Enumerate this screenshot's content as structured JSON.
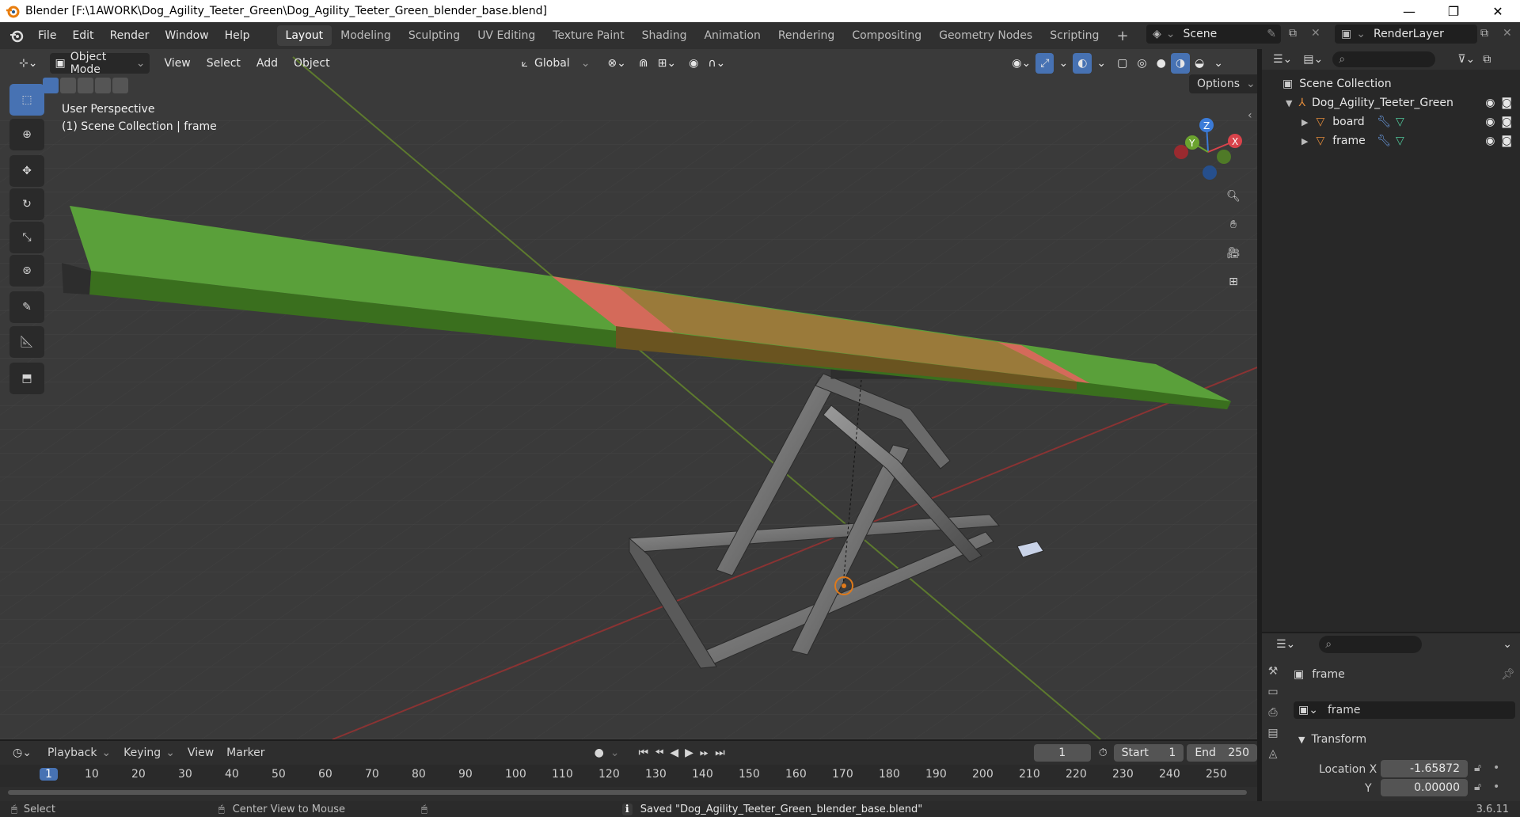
{
  "window": {
    "title": "Blender [F:\\1AWORK\\Dog_Agility_Teeter_Green\\Dog_Agility_Teeter_Green_blender_base.blend]",
    "minimize": "—",
    "maximize": "❐",
    "close": "✕"
  },
  "menus": [
    "File",
    "Edit",
    "Render",
    "Window",
    "Help"
  ],
  "workspaces": [
    "Layout",
    "Modeling",
    "Sculpting",
    "UV Editing",
    "Texture Paint",
    "Shading",
    "Animation",
    "Rendering",
    "Compositing",
    "Geometry Nodes",
    "Scripting"
  ],
  "active_workspace": "Layout",
  "scene": {
    "name": "Scene",
    "render_layer": "RenderLayer"
  },
  "viewport_header": {
    "mode": "Object Mode",
    "menus": [
      "View",
      "Select",
      "Add",
      "Object"
    ],
    "orientation": "Global",
    "options": "Options"
  },
  "viewport_info": {
    "line1": "User Perspective",
    "line2": "(1) Scene Collection | frame"
  },
  "gizmo": {
    "x": "X",
    "y": "Y",
    "z": "Z"
  },
  "outliner": {
    "scene_collection": "Scene Collection",
    "collection": "Dog_Agility_Teeter_Green",
    "objects": [
      "board",
      "frame"
    ]
  },
  "properties": {
    "object_name": "frame",
    "object_name_field": "frame",
    "panel": "Transform",
    "location_x_label": "Location X",
    "location_x": "-1.65872",
    "location_y_label": "Y",
    "location_y": "0.00000"
  },
  "timeline": {
    "menus": [
      "Playback",
      "Keying",
      "View",
      "Marker"
    ],
    "current_frame": "1",
    "start_label": "Start",
    "start": "1",
    "end_label": "End",
    "end": "250",
    "ruler": [
      "1",
      "10",
      "20",
      "30",
      "40",
      "50",
      "60",
      "70",
      "80",
      "90",
      "100",
      "110",
      "120",
      "130",
      "140",
      "150",
      "160",
      "170",
      "180",
      "190",
      "200",
      "210",
      "220",
      "230",
      "240",
      "250"
    ]
  },
  "status": {
    "select": "Select",
    "center_view": "Center View to Mouse",
    "message": "Saved \"Dog_Agility_Teeter_Green_blender_base.blend\"",
    "version": "3.6.11"
  }
}
